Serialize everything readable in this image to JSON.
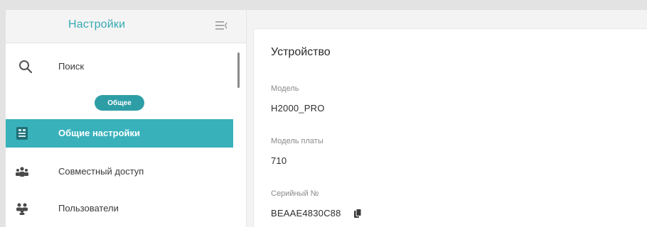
{
  "sidebar": {
    "title": "Настройки",
    "collapse_icon": "menu-collapse-icon",
    "search": {
      "label": "Поиск",
      "icon": "search-icon"
    },
    "section_label": "Общее",
    "items": [
      {
        "label": "Общие настройки",
        "icon": "settings-panel-icon",
        "active": true
      },
      {
        "label": "Совместный доступ",
        "icon": "shared-access-icon",
        "active": false
      },
      {
        "label": "Пользователи",
        "icon": "users-icon",
        "active": false
      }
    ]
  },
  "main": {
    "section_title": "Устройство",
    "fields": [
      {
        "label": "Модель",
        "value": "H2000_PRO"
      },
      {
        "label": "Модель платы",
        "value": "710"
      },
      {
        "label": "Серийный №",
        "value": "BEAAE4830C88",
        "copy_icon": "copy-icon"
      }
    ]
  },
  "colors": {
    "accent": "#38b1bb",
    "pill": "#2e9ea6",
    "title": "#36a9b4"
  }
}
